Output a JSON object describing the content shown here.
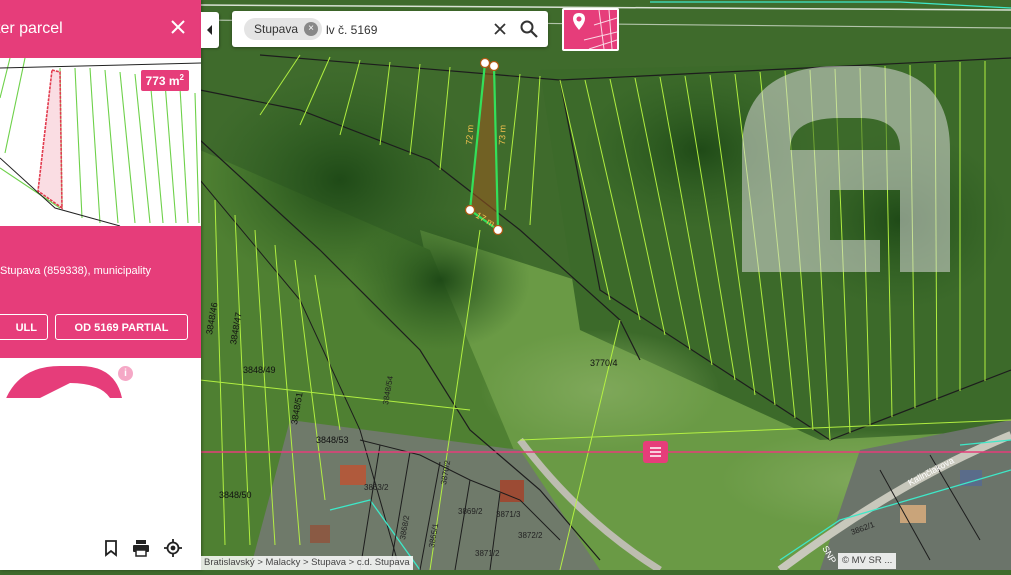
{
  "panel": {
    "title": "ter parcel",
    "area_value": "773 m",
    "area_unit_sup": "2",
    "location_text": "Stupava (859338), municipality",
    "full_button_label": "ULL",
    "partial_button_label": "OD 5169 PARTIAL",
    "info_icon": "i",
    "tools": [
      "bookmark-icon",
      "print-icon",
      "locate-icon"
    ]
  },
  "search": {
    "chip_label": "Stupava",
    "chip_remove": "×",
    "query": "lv č. 5169"
  },
  "map": {
    "parcel_labels": [
      "3770/4",
      "3848/49",
      "3848/47",
      "3848/46",
      "3848/51",
      "3848/53",
      "3848/50",
      "3848/54",
      "3863/2",
      "3871/2",
      "3872/2",
      "3869/2",
      "3868/2",
      "3871/3",
      "3870/2",
      "3865/1",
      "3862/1"
    ],
    "street_labels": [
      "Kalinčiakova",
      "SNP"
    ],
    "edge_labels": [
      "72 m",
      "73 m",
      "17 m"
    ],
    "watermark_label": "G",
    "breadcrumb": "Bratislavský > Malacky > Stupava > c.d. Stupava",
    "copyright": "© MV SR ..."
  },
  "colors": {
    "accent": "#e63d7a",
    "parcel_line": "#b7f542",
    "boundary": "#1d1d1d",
    "selected": "#33e05a",
    "cadastre": "#3ee8c8"
  }
}
